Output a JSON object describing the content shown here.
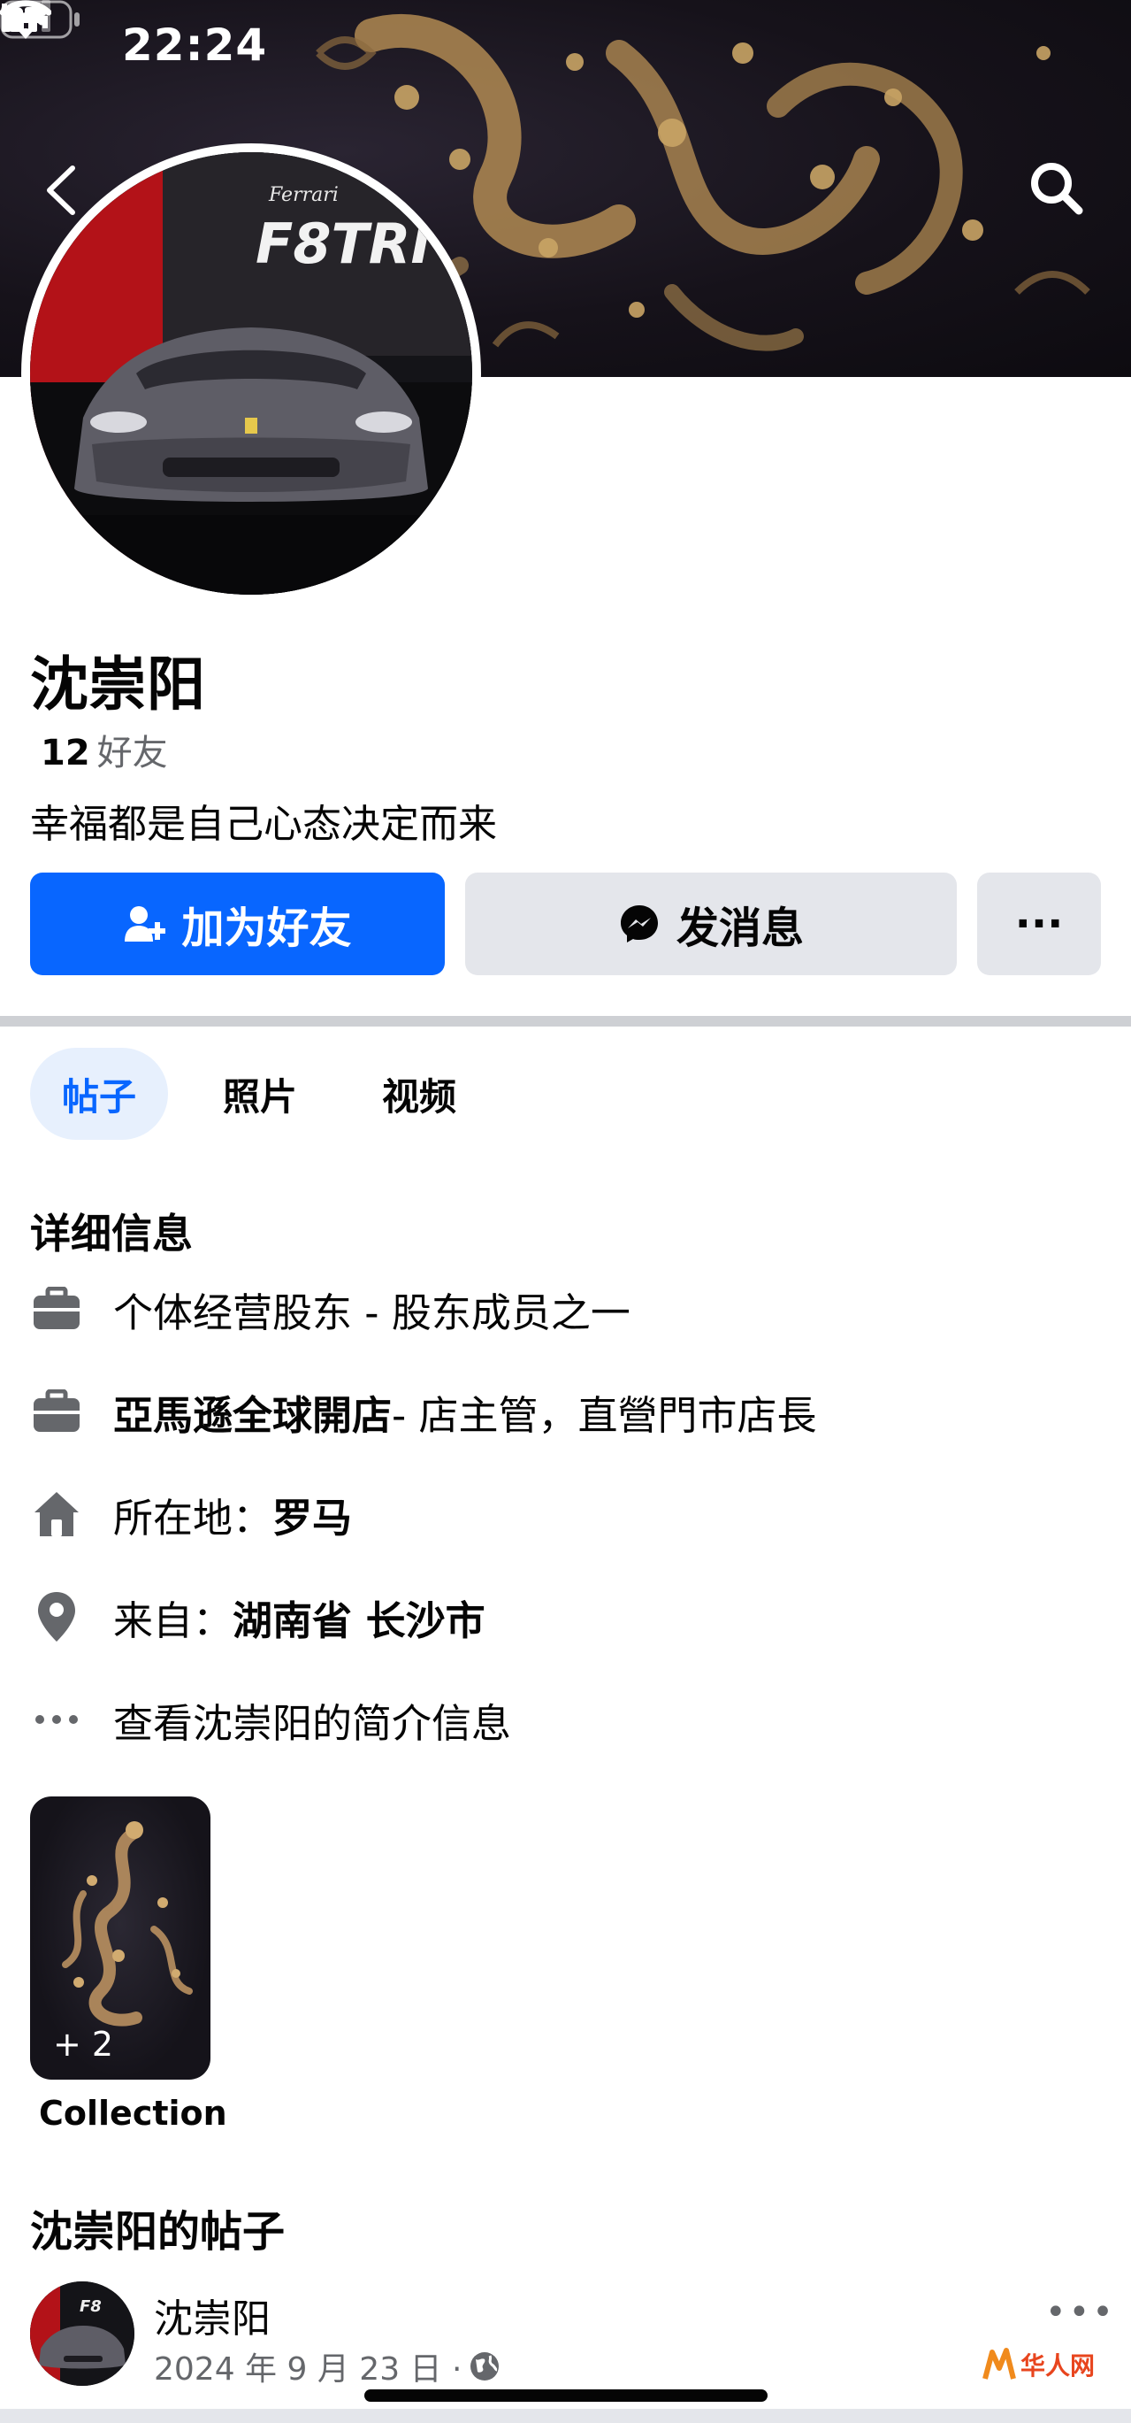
{
  "status_bar": {
    "time": "22:24"
  },
  "profile": {
    "name": "沈崇阳",
    "friends_count": "12",
    "friends_label": "好友",
    "bio": "幸福都是自己心态决定而来"
  },
  "actions": {
    "add_friend": "加为好友",
    "message": "发消息",
    "more": "···"
  },
  "tabs": [
    {
      "label": "帖子",
      "active": true
    },
    {
      "label": "照片",
      "active": false
    },
    {
      "label": "视频",
      "active": false
    }
  ],
  "details": {
    "title": "详细信息",
    "work_1": {
      "text": "个体经营股东 - 股东成员之一"
    },
    "work_2": {
      "bold": "亞馬遜全球開店",
      "rest": " - 店主管，直營門市店長"
    },
    "lives": {
      "label": "所在地：",
      "value": "罗马"
    },
    "from": {
      "label": "来自：",
      "value": "湖南省 长沙市"
    },
    "about": "查看沈崇阳的简介信息"
  },
  "collection": {
    "count": "+ 2",
    "label": "Collection"
  },
  "posts": {
    "title": "沈崇阳的帖子",
    "first": {
      "author": "沈崇阳",
      "date": "2024 年 9 月 23 日 ·",
      "more": "•••"
    }
  },
  "watermark": {
    "text": "华人网"
  },
  "colors": {
    "primary": "#0866ff",
    "secondary_bg": "#e4e6eb",
    "muted_text": "#65676b"
  }
}
